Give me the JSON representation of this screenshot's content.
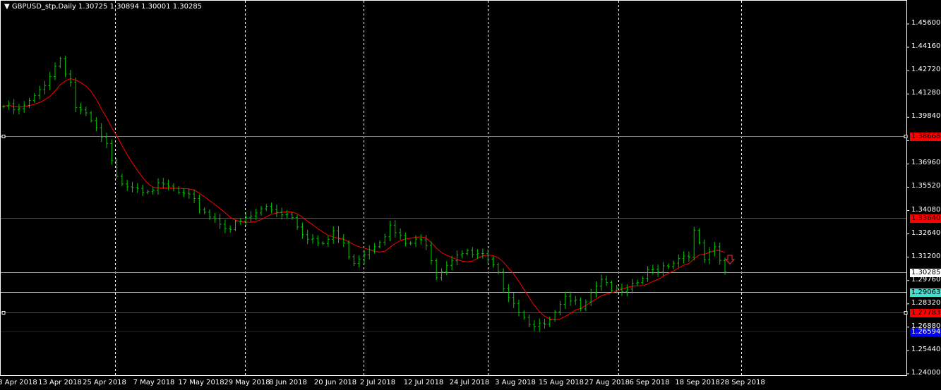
{
  "header": {
    "arrow": "▼",
    "symbol": "GBPUSD_stp,Daily",
    "open": "1.30725",
    "high": "1.30894",
    "low": "1.30001",
    "close": "1.30285"
  },
  "colors": {
    "bars": "#00c800",
    "ma": "#ff0000",
    "grid": "#ffffff",
    "axis": "#ffffff"
  },
  "chart_data": {
    "type": "ohlc-bar",
    "symbol": "GBPUSD_stp",
    "timeframe": "Daily",
    "ylim": [
      1.24,
      1.456
    ],
    "y_ticks": [
      "1.45600",
      "1.44160",
      "1.42720",
      "1.41280",
      "1.39840",
      "1.38400",
      "1.36960",
      "1.35520",
      "1.34080",
      "1.32640",
      "1.31200",
      "1.29760",
      "1.28320",
      "1.26880",
      "1.25440",
      "1.24000"
    ],
    "x_ticks": [
      "3 Apr 2018",
      "13 Apr 2018",
      "25 Apr 2018",
      "7 May 2018",
      "17 May 2018",
      "29 May 2018",
      "8 Jun 2018",
      "20 Jun 2018",
      "2 Jul 2018",
      "12 Jul 2018",
      "24 Jul 2018",
      "3 Aug 2018",
      "15 Aug 2018",
      "27 Aug 2018",
      "6 Sep 2018",
      "18 Sep 2018",
      "28 Sep 2018"
    ],
    "bar_count": 141,
    "close_keypoints": [
      [
        0,
        1.405
      ],
      [
        3,
        1.402
      ],
      [
        6,
        1.41
      ],
      [
        10,
        1.43
      ],
      [
        11,
        1.435
      ],
      [
        13,
        1.42
      ],
      [
        14,
        1.405
      ],
      [
        17,
        1.395
      ],
      [
        20,
        1.38
      ],
      [
        22,
        1.36
      ],
      [
        27,
        1.355
      ],
      [
        32,
        1.355
      ],
      [
        36,
        1.348
      ],
      [
        40,
        1.338
      ],
      [
        44,
        1.33
      ],
      [
        47,
        1.335
      ],
      [
        51,
        1.343
      ],
      [
        56,
        1.338
      ],
      [
        58,
        1.328
      ],
      [
        62,
        1.318
      ],
      [
        64,
        1.328
      ],
      [
        68,
        1.31
      ],
      [
        71,
        1.318
      ],
      [
        75,
        1.33
      ],
      [
        78,
        1.32
      ],
      [
        82,
        1.322
      ],
      [
        84,
        1.302
      ],
      [
        88,
        1.315
      ],
      [
        93,
        1.312
      ],
      [
        95,
        1.305
      ],
      [
        98,
        1.29
      ],
      [
        101,
        1.275
      ],
      [
        105,
        1.268
      ],
      [
        109,
        1.285
      ],
      [
        112,
        1.283
      ],
      [
        116,
        1.3
      ],
      [
        119,
        1.29
      ],
      [
        121,
        1.29
      ],
      [
        125,
        1.302
      ],
      [
        130,
        1.31
      ],
      [
        133,
        1.315
      ],
      [
        134,
        1.327
      ],
      [
        136,
        1.31
      ],
      [
        138,
        1.316
      ],
      [
        140,
        1.30285
      ]
    ],
    "moving_average": {
      "type": "SMA",
      "period": 8,
      "color": "#ff0000"
    },
    "levels": [
      {
        "label": "1.38668",
        "value": 1.38668,
        "line": "#808080",
        "bg": "#ff0000",
        "fg": "#000000"
      },
      {
        "label": "1.33640",
        "value": 1.3364,
        "line": "#ff0000",
        "bg": "#ff0000",
        "fg": "#000000"
      },
      {
        "label": "1.30285",
        "value": 1.30285,
        "line": "#a0a0a0",
        "bg": "#ffffff",
        "fg": "#000000"
      },
      {
        "label": "1.29063",
        "value": 1.29063,
        "line": "#c8c8c8",
        "bg": "#40e0d0",
        "fg": "#000000"
      },
      {
        "label": "1.27783",
        "value": 1.27783,
        "line": "#ff0000",
        "bg": "#ff0000",
        "fg": "#000000"
      },
      {
        "label": "1.26594",
        "value": 1.26594,
        "line": "#202020",
        "bg": "#0000ff",
        "fg": "#ffffff"
      }
    ]
  }
}
